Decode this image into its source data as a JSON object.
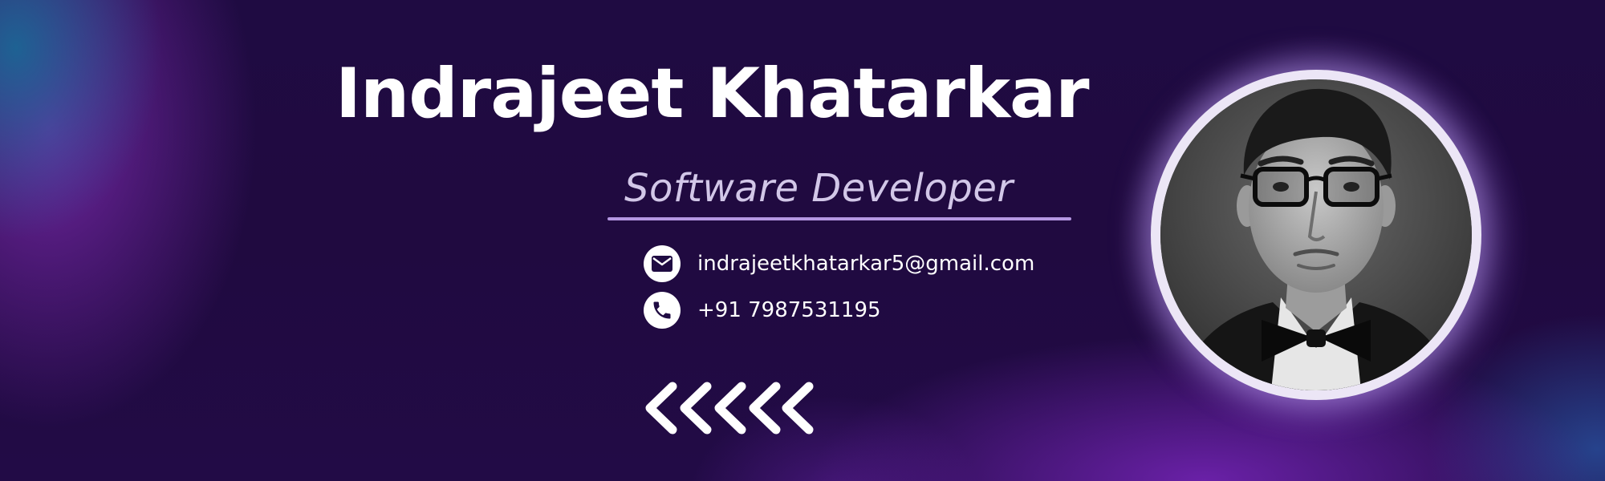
{
  "profile": {
    "name": "Indrajeet Khatarkar",
    "title": "Software Developer"
  },
  "contact": {
    "email": "indrajeetkhatarkar5@gmail.com",
    "phone": "+91 7987531195"
  },
  "icons": {
    "email": "mail-icon",
    "phone": "phone-icon",
    "decoration": "chevrons-left-icon"
  },
  "colors": {
    "background": "#1f0b42",
    "accent": "#b497e2",
    "text": "#ffffff",
    "subtitle": "#d2c7e8"
  }
}
